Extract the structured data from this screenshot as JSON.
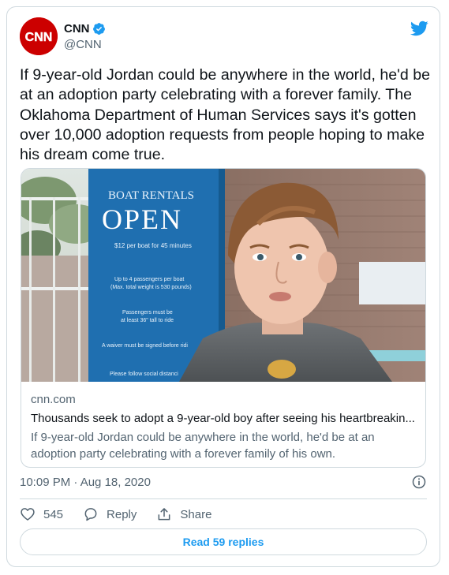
{
  "author": {
    "name": "CNN",
    "handle": "@CNN",
    "avatar_text": "CNN",
    "verified": true
  },
  "tweet": {
    "text": "If 9-year-old Jordan could be anywhere in the world, he'd be at an adoption party celebrating with a forever family. The Oklahoma Department of Human Services says it's gotten over 10,000 adoption requests from people hoping to make his dream come true.",
    "timestamp": "10:09 PM · Aug 18, 2020"
  },
  "card": {
    "domain": "cnn.com",
    "title": "Thousands seek to adopt a 9-year-old boy after seeing his heartbreakin...",
    "description": "If 9-year-old Jordan could be anywhere in the world, he'd be at an adoption party celebrating with a forever family of his own.",
    "image": {
      "sign_line1": "BOAT RENTALS",
      "sign_line2": "OPEN",
      "sign_line3": "$12 per boat for 45 minutes",
      "sign_line4": "Up to 4 passengers per boat",
      "sign_line5": "(Max. total weight is 530 pounds)",
      "sign_line6": "Passengers must be",
      "sign_line7": "at least 36\" tall to ride",
      "sign_line8": "A waiver must be signed before ridi",
      "sign_line9": "Please follow social distanci"
    }
  },
  "actions": {
    "likes": "545",
    "reply_label": "Reply",
    "share_label": "Share"
  },
  "read_replies_label": "Read 59 replies",
  "colors": {
    "accent": "#1d9bf0",
    "secondary_text": "#536471",
    "border": "#cfd9de",
    "cnn_red": "#cc0000"
  }
}
